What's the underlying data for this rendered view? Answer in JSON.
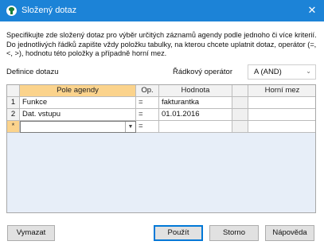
{
  "window": {
    "title": "Složený dotaz",
    "close_glyph": "✕"
  },
  "description": "Specifikujte zde složený dotaz pro výběr určitých záznamů agendy podle jednoho či více kriterií. Do jednotlivých řádků zapište vždy položku tabulky, na kterou chcete uplatnit dotaz, operátor (=, <, >), hodnotu této položky a případně horní mez.",
  "definition": {
    "label": "Definice dotazu",
    "operator_label": "Řádkový operátor",
    "operator_value": "A (AND)"
  },
  "grid": {
    "columns": [
      "",
      "Pole agendy",
      "Op.",
      "Hodnota",
      "",
      "Horní mez"
    ],
    "rows": [
      {
        "num": "1",
        "field": "Funkce",
        "op": "=",
        "value": "fakturantka",
        "upper": ""
      },
      {
        "num": "2",
        "field": "Dat. vstupu",
        "op": "=",
        "value": "01.01.2016",
        "upper": ""
      }
    ],
    "new_row": {
      "marker": "*",
      "field": "",
      "op": "="
    }
  },
  "buttons": {
    "clear": "Vymazat",
    "use": "Použít",
    "cancel": "Storno",
    "help": "Nápověda"
  },
  "icons": {
    "app": "app-icon",
    "dropdown": "chevron-down-icon"
  }
}
